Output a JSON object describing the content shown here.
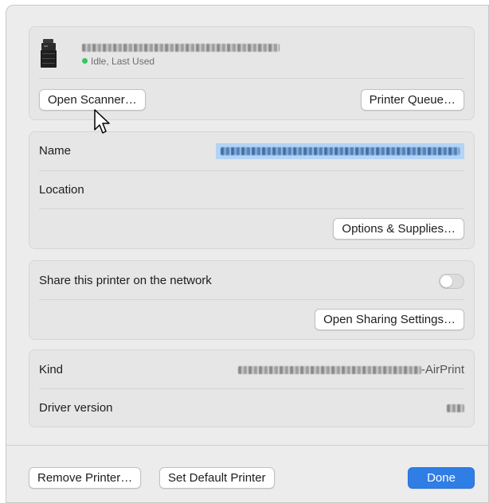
{
  "printer": {
    "status_text": "Idle, Last Used",
    "status_color": "#34c759",
    "icon": "printer-icon"
  },
  "buttons": {
    "open_scanner": "Open Scanner…",
    "printer_queue": "Printer Queue…",
    "options_supplies": "Options & Supplies…",
    "open_sharing": "Open Sharing Settings…",
    "remove_printer": "Remove Printer…",
    "set_default": "Set Default Printer",
    "done": "Done"
  },
  "info": {
    "name_label": "Name",
    "location_label": "Location"
  },
  "sharing": {
    "label": "Share this printer on the network",
    "enabled": false
  },
  "details": {
    "kind_label": "Kind",
    "kind_suffix": "-AirPrint",
    "driver_label": "Driver version"
  },
  "colors": {
    "accent": "#2f7ee6",
    "selection": "#b3d4f5"
  }
}
